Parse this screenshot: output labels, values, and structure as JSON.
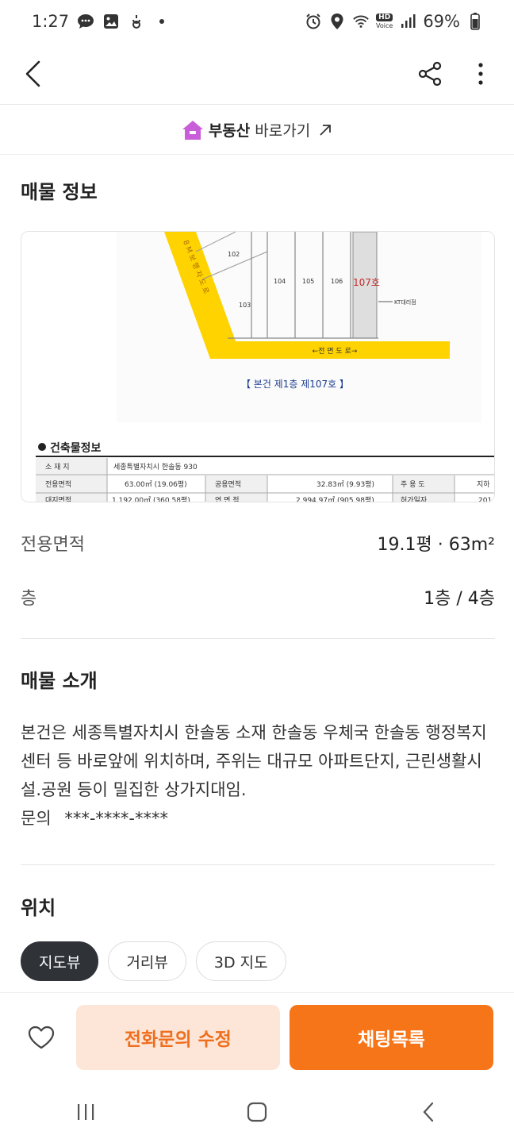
{
  "status": {
    "time": "1:27",
    "battery": "69%",
    "net_badge_top": "HD",
    "net_badge_bottom": "Voice"
  },
  "shortcut": {
    "brand": "부동산",
    "label": "바로가기"
  },
  "listing_info": {
    "title": "매물 정보",
    "image": {
      "road_vertical": "8 M 보 행 자 도 로",
      "road_horizontal": "←전 면 도 로→",
      "lot_numbers": [
        "102",
        "103",
        "104",
        "105",
        "106"
      ],
      "highlight_unit": "107호",
      "neighbor_label": "KT대리점",
      "caption": "【 본건 제1층 제107호 】",
      "table_title": "건축물정보",
      "table_rows": [
        [
          "소 재 지",
          "세종특별자치시 한솔동 930",
          "",
          "",
          "",
          ""
        ],
        [
          "전용면적",
          "63.00㎡ (19.06평)",
          "공용면적",
          "32.83㎡ (9.93평)",
          "주 용 도",
          "지하"
        ],
        [
          "대지면적",
          "1,192.00㎡ (360.58평)",
          "연 면 적",
          "2,994.97㎡ (905.98평)",
          "허가일자",
          "201"
        ]
      ]
    }
  },
  "details": [
    {
      "label": "전용면적",
      "value": "19.1평 · 63m²"
    },
    {
      "label": "층",
      "value": "1층 / 4층"
    }
  ],
  "intro": {
    "title": "매물 소개",
    "body": "본건은 세종특별자치시 한솔동 소재 한솔동 우체국  한솔동 행정복지센터 등 바로앞에 위치하며, 주위는 대규모 아파트단지, 근린생활시설.공원 등이 밀집한 상가지대임.",
    "contact_label": "문의",
    "contact_value": "***-****-****"
  },
  "location": {
    "title": "위치",
    "tabs": [
      "지도뷰",
      "거리뷰",
      "3D 지도"
    ]
  },
  "actions": {
    "call": "전화문의 수정",
    "chat": "채팅목록"
  },
  "colors": {
    "accent": "#f77519",
    "accent_light": "#fde6d7",
    "road_yellow": "#ffd300",
    "chip_active": "#2f3338"
  }
}
